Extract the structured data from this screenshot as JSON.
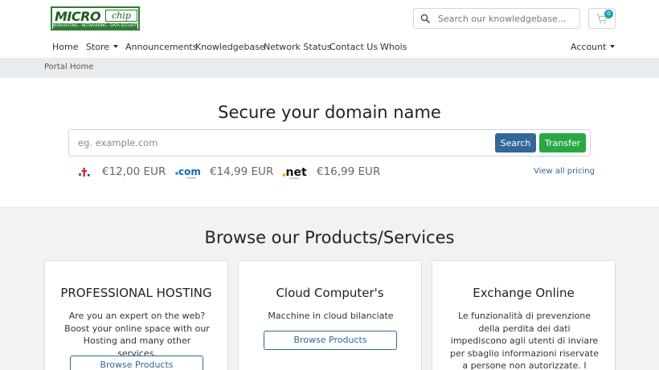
{
  "header": {
    "logo": {
      "main": "MICRO",
      "chip": "chip",
      "tagline": "WEBHOSTING - NETWORKING - DATA SECURITY"
    },
    "search_placeholder": "Search our knowledgebase...",
    "cart_count": "0"
  },
  "nav": {
    "items": [
      {
        "label": "Home"
      },
      {
        "label": "Store"
      },
      {
        "label": "Announcements"
      },
      {
        "label": "Knowledgebase"
      },
      {
        "label": "Network Status"
      },
      {
        "label": "Contact Us"
      },
      {
        "label": "Whois"
      }
    ],
    "account": "Account"
  },
  "breadcrumb": {
    "current": "Portal Home"
  },
  "domain": {
    "title": "Secure your domain name",
    "placeholder": "eg. example.com",
    "search_label": "Search",
    "transfer_label": "Transfer",
    "tlds": [
      {
        "name": ".it",
        "price": "€12,00 EUR"
      },
      {
        "name": ".com",
        "price": "€14,99 EUR"
      },
      {
        "name": ".net",
        "price": "€16,99 EUR"
      }
    ],
    "view_pricing": "View all pricing"
  },
  "products": {
    "title": "Browse our Products/Services",
    "cards": [
      {
        "title": "PROFESSIONAL HOSTING",
        "description": "Are you an expert on the web? Boost your online space with our Hosting and many other services.",
        "button": "Browse Products"
      },
      {
        "title": "Cloud Computer's",
        "description": "Macchine in cloud bilanciate",
        "button": "Browse Products"
      },
      {
        "title": "Exchange Online",
        "description": "Le funzionalità di prevenzione della perdita dei dati impediscono agli utenti di inviare per sbaglio informazioni riservate a persone non autorizzate. I server",
        "button": ""
      }
    ]
  },
  "colors": {
    "primary": "#336699",
    "success": "#28a745",
    "badge": "#17a2b8",
    "logo_green": "#2e7d32"
  }
}
